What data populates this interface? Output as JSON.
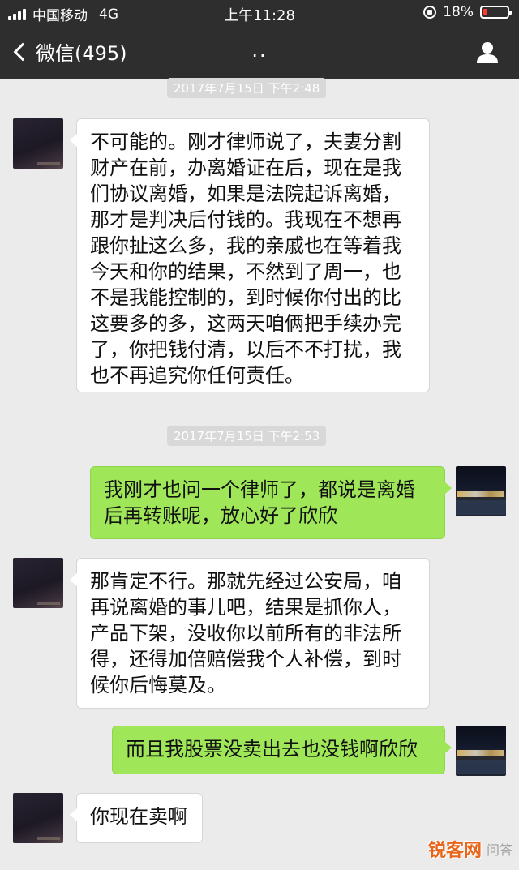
{
  "status_bar": {
    "carrier": "中国移动",
    "network": "4G",
    "time": "上午11:28",
    "battery": "18%",
    "battery_level": 0.18,
    "battery_color": "#ff3b30"
  },
  "nav": {
    "back_label": "微信(495)",
    "title": "..",
    "back_icon": "chevron-left-icon",
    "profile_icon": "person-icon"
  },
  "messages": [
    {
      "type": "timestamp",
      "text": "2017年7月15日 下午2:48"
    },
    {
      "type": "incoming",
      "text": "不可能的。刚才律师说了，夫妻分割财产在前，办离婚证在后，现在是我们协议离婚，如果是法院起诉离婚，那才是判决后付钱的。我现在不想再跟你扯这么多，我的亲戚也在等着我今天和你的结果，不然到了周一，也不是我能控制的，到时候你付出的比这要多的多，这两天咱俩把手续办完了，你把钱付清，以后不不打扰，我也不再追究你任何责任。"
    },
    {
      "type": "timestamp",
      "text": "2017年7月15日 下午2:53"
    },
    {
      "type": "outgoing",
      "text": "我刚才也问一个律师了，都说是离婚后再转账呢，放心好了欣欣"
    },
    {
      "type": "incoming",
      "text": "那肯定不行。那就先经过公安局，咱再说离婚的事儿吧，结果是抓你人，产品下架，没收你以前所有的非法所得，还得加倍赔偿我个人补偿，到时候你后悔莫及。"
    },
    {
      "type": "outgoing",
      "text": "而且我股票没卖出去也没钱啊欣欣"
    },
    {
      "type": "incoming",
      "text": "你现在卖啊"
    }
  ],
  "watermark": {
    "brand": "锐客网",
    "sub": "问答"
  },
  "colors": {
    "header": "#2e2e2e",
    "chat_bg": "#ebebeb",
    "incoming_bubble": "#ffffff",
    "outgoing_bubble": "#9fe658"
  }
}
